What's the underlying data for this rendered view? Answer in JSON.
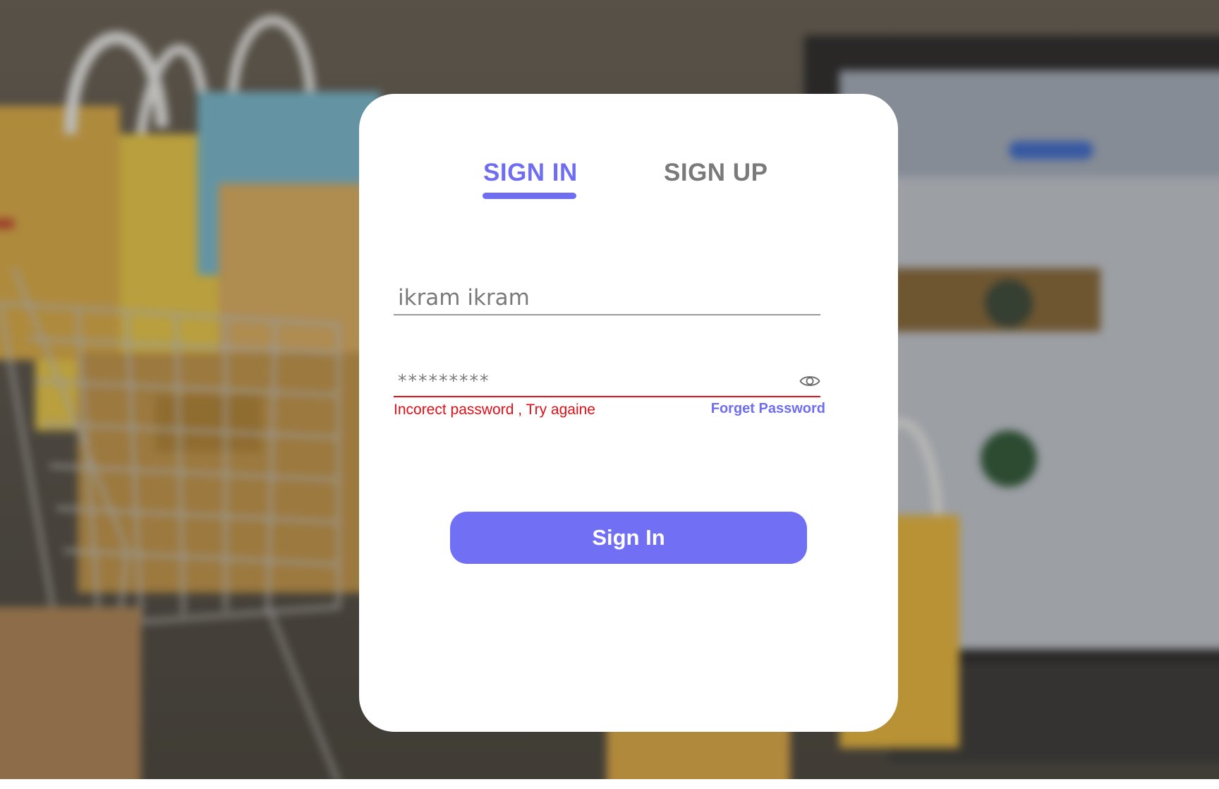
{
  "auth": {
    "tabs": {
      "signin_label": "SIGN IN",
      "signup_label": "SIGN UP",
      "active": "signin"
    },
    "username": {
      "value": "ikram ikram"
    },
    "password": {
      "masked_value": "*********"
    },
    "error_message": "Incorect password , Try againe",
    "forgot_password_label": "Forget Password",
    "submit_label": "Sign In"
  },
  "icons": {
    "password_visibility": "eye-icon"
  },
  "colors": {
    "accent": "#7170f5",
    "tab_active": "#6f6ef3",
    "tab_inactive": "#7a7a7a",
    "error": "#e20f17",
    "card_background": "#ffffff",
    "input_text": "#7a7a7a"
  }
}
